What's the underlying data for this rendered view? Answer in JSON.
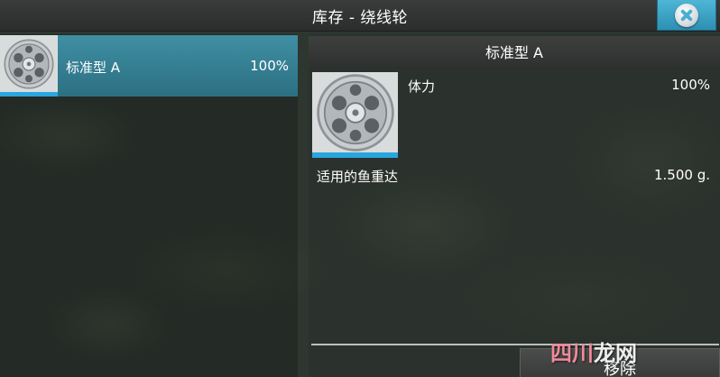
{
  "header": {
    "title": "库存 - 绕线轮"
  },
  "inventory_list": {
    "items": [
      {
        "name": "标准型 A",
        "condition": "100%",
        "icon": "fly-reel-icon",
        "selected": true
      }
    ]
  },
  "detail": {
    "title": "标准型 A",
    "icon": "fly-reel-icon",
    "stats": [
      {
        "label": "体力",
        "value": "100%"
      },
      {
        "label": "适用的鱼重达",
        "value": "1.500 g."
      }
    ],
    "remove_label": "移除"
  },
  "watermark": {
    "part1": "四川",
    "part2": "龙网"
  },
  "colors": {
    "accent": "#2aa6de",
    "selected_row": "#3f8fa3",
    "close_button": "#3ea6c9"
  }
}
